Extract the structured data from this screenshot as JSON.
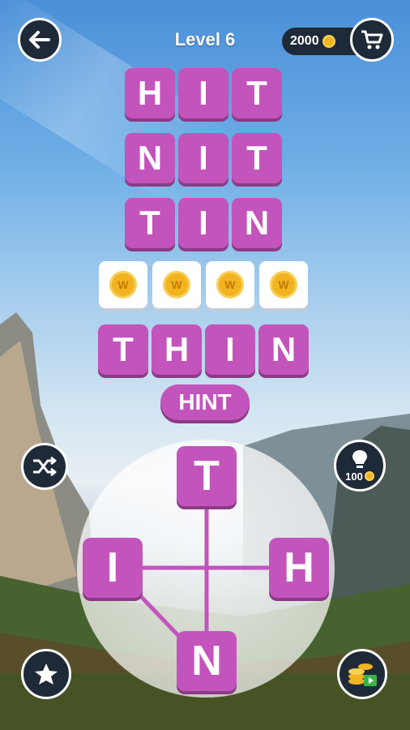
{
  "header": {
    "level": "Level 6",
    "coins": "2000"
  },
  "rows": [
    [
      "H",
      "I",
      "T"
    ],
    [
      "N",
      "I",
      "T"
    ],
    [
      "T",
      "I",
      "N"
    ]
  ],
  "hidden_word_slots": [
    "W",
    "W",
    "W",
    "W"
  ],
  "current_word": [
    "T",
    "H",
    "I",
    "N"
  ],
  "hint_label": "HINT",
  "wheel_letters": {
    "top": "T",
    "left": "I",
    "right": "H",
    "bottom": "N"
  },
  "hint_cost": "100",
  "colors": {
    "tile": "#c354bc",
    "tile_shadow": "#8c3a86",
    "button_bg": "#1f2a38",
    "coin": "#f4b321"
  },
  "icons": [
    "back-arrow-icon",
    "shopping-cart-icon",
    "shuffle-icon",
    "lightbulb-icon",
    "star-icon",
    "coins-video-icon"
  ]
}
